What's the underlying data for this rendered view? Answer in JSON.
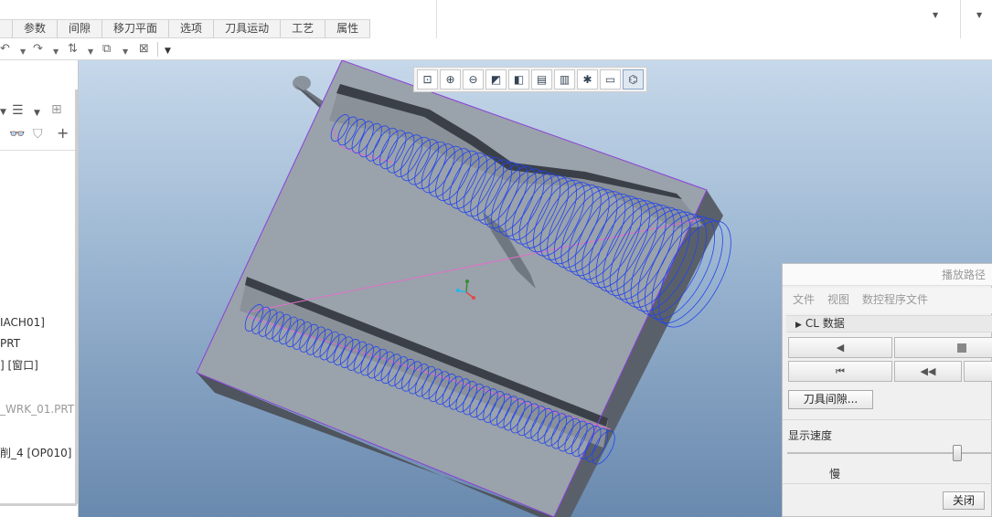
{
  "ribbon": {
    "tabs": [
      "",
      "参数",
      "间隙",
      "移刀平面",
      "选项",
      "刀具运动",
      "工艺",
      "属性"
    ]
  },
  "quick_access": {
    "icons": [
      "undo-icon",
      "redo-icon",
      "regenerate-icon",
      "window-icon",
      "close-window-icon",
      "more-icon"
    ]
  },
  "left_panel": {
    "tree_items": [
      "IACH01]",
      "PRT",
      "] [窗口]",
      "_WRK_01.PRT",
      "削_4 [OP010]"
    ]
  },
  "view_toolbar": {
    "buttons": [
      "zoom-fit-icon",
      "zoom-in-icon",
      "zoom-out-icon",
      "repaint-icon",
      "display-style-icon",
      "saved-views-icon",
      "view-manager-icon",
      "datum-display-icon",
      "annotation-icon",
      "toolpath-display-icon"
    ]
  },
  "dialog": {
    "title": "播放路径",
    "menu": [
      "文件",
      "视图",
      "数控程序文件"
    ],
    "cl_section": "CL 数据",
    "clearance_button": "刀具间隙...",
    "speed_label": "显示速度",
    "slow_label": "慢",
    "close_button": "关闭",
    "playback_speed": 0.85
  },
  "colors": {
    "toolpath": "#2244ee",
    "rapid_move": "#e070c8",
    "part_top": "#9aa2ab",
    "part_side": "#5f6770",
    "accent": "#8aa6c4"
  }
}
